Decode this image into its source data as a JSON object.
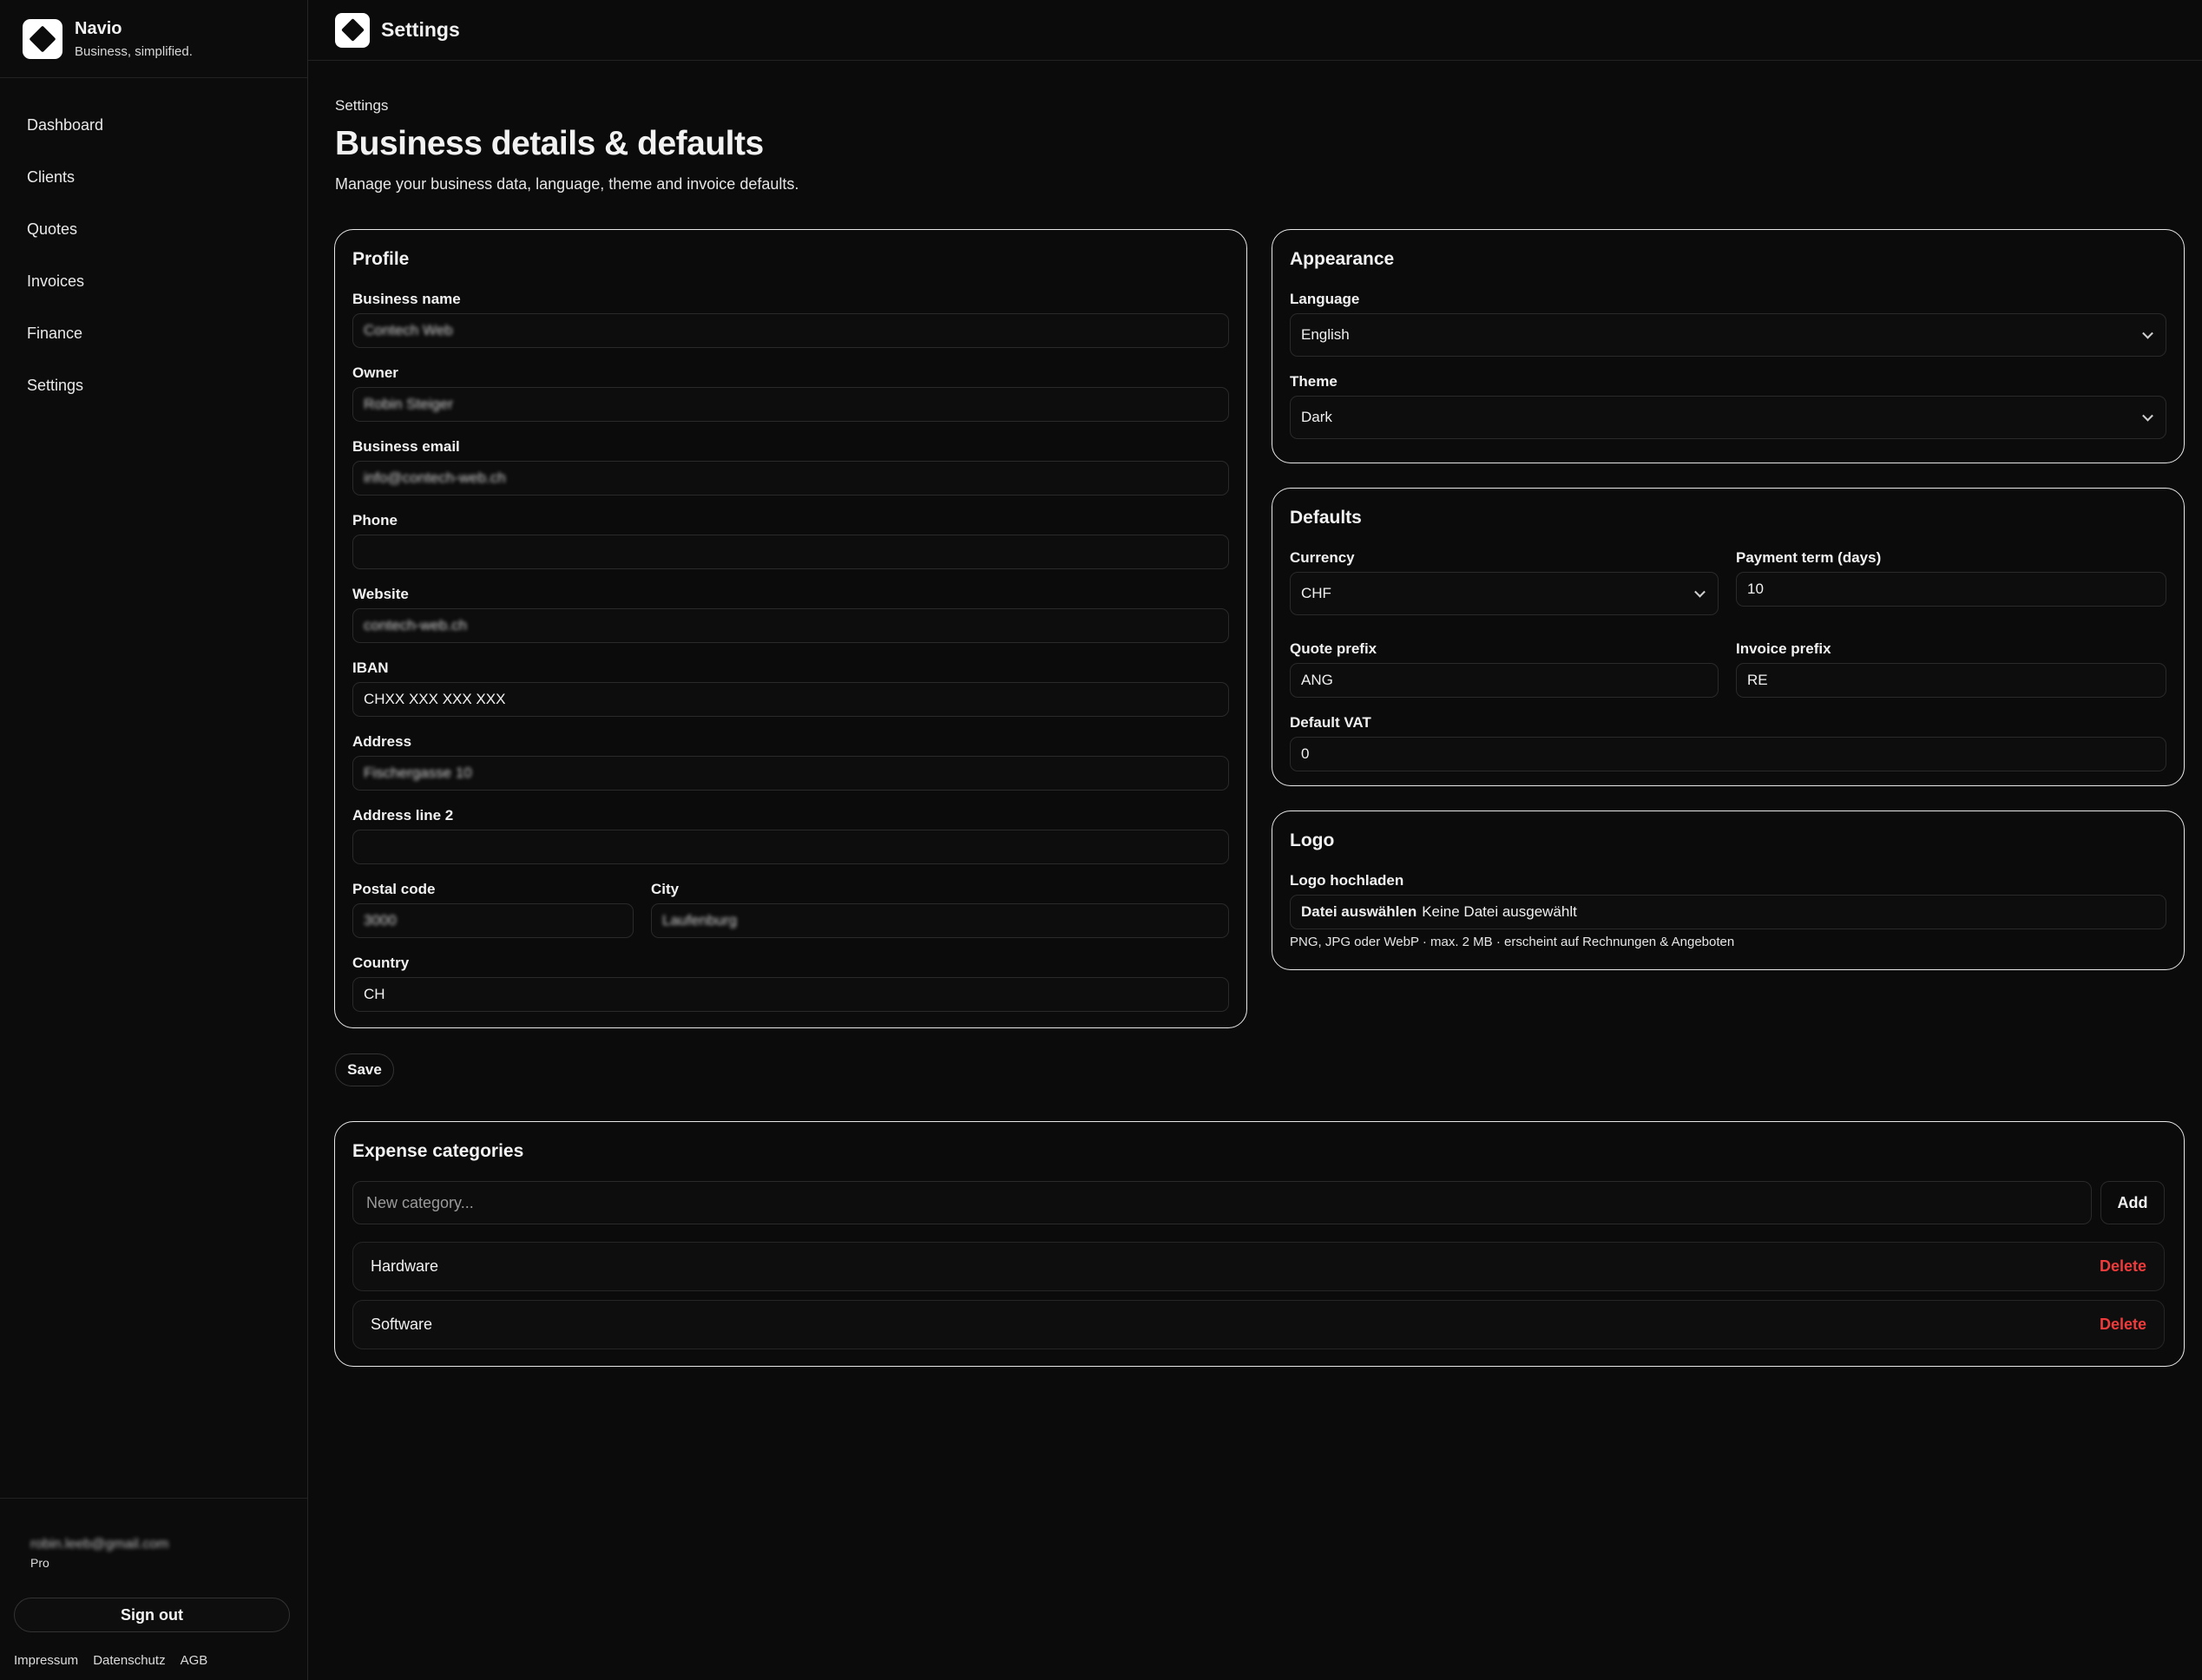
{
  "brand": {
    "name": "Navio",
    "tagline": "Business, simplified."
  },
  "sidebar": {
    "items": [
      {
        "label": "Dashboard"
      },
      {
        "label": "Clients"
      },
      {
        "label": "Quotes"
      },
      {
        "label": "Invoices"
      },
      {
        "label": "Finance"
      },
      {
        "label": "Settings"
      }
    ],
    "user_email": "robin.leeb@gmail.com",
    "user_plan": "Pro",
    "signout_label": "Sign out",
    "legal": [
      "Impressum",
      "Datenschutz",
      "AGB"
    ]
  },
  "topbar": {
    "title": "Settings"
  },
  "header": {
    "breadcrumb": "Settings",
    "title": "Business details & defaults",
    "subtitle": "Manage your business data, language, theme and invoice defaults."
  },
  "profile": {
    "title": "Profile",
    "business_name": {
      "label": "Business name",
      "value": "Contech Web"
    },
    "owner": {
      "label": "Owner",
      "value": "Robin Steiger"
    },
    "business_email": {
      "label": "Business email",
      "value": "info@contech-web.ch"
    },
    "phone": {
      "label": "Phone",
      "value": ""
    },
    "website": {
      "label": "Website",
      "value": "contech-web.ch"
    },
    "iban": {
      "label": "IBAN",
      "value": "CHXX XXX XXX XXX"
    },
    "address": {
      "label": "Address",
      "value": "Fischergasse 10"
    },
    "address2": {
      "label": "Address line 2",
      "value": ""
    },
    "postal_code": {
      "label": "Postal code",
      "value": "3000"
    },
    "city": {
      "label": "City",
      "value": "Laufenburg"
    },
    "country": {
      "label": "Country",
      "value": "CH"
    }
  },
  "appearance": {
    "title": "Appearance",
    "language": {
      "label": "Language",
      "value": "English"
    },
    "theme": {
      "label": "Theme",
      "value": "Dark"
    }
  },
  "defaults": {
    "title": "Defaults",
    "currency": {
      "label": "Currency",
      "value": "CHF"
    },
    "payment_term": {
      "label": "Payment term (days)",
      "value": "10"
    },
    "quote_prefix": {
      "label": "Quote prefix",
      "value": "ANG"
    },
    "invoice_prefix": {
      "label": "Invoice prefix",
      "value": "RE"
    },
    "default_vat": {
      "label": "Default VAT",
      "value": "0"
    }
  },
  "logo": {
    "title": "Logo",
    "upload_label": "Logo hochladen",
    "file_button": "Datei auswählen",
    "file_status": "Keine Datei ausgewählt",
    "hint": "PNG, JPG oder WebP · max. 2 MB · erscheint auf Rechnungen & Angeboten"
  },
  "save_label": "Save",
  "expenses": {
    "title": "Expense categories",
    "placeholder": "New category...",
    "add_label": "Add",
    "delete_label": "Delete",
    "categories": [
      {
        "name": "Hardware"
      },
      {
        "name": "Software"
      }
    ]
  },
  "colors": {
    "accent_danger": "#ef3b3b",
    "background": "#0b0b0b",
    "border": "#e8e8e8"
  }
}
